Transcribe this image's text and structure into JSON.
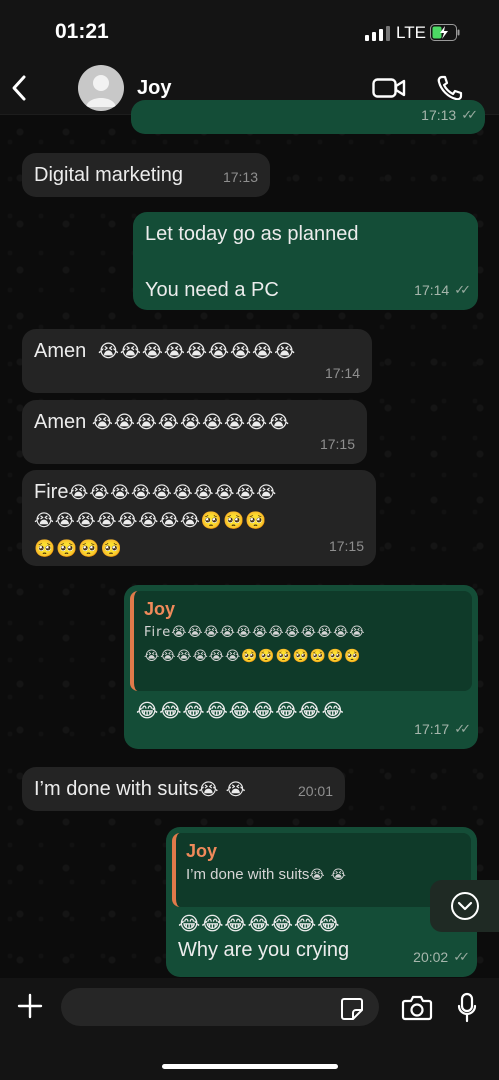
{
  "status": {
    "time": "01:21",
    "network": "LTE"
  },
  "header": {
    "contact_name": "Joy"
  },
  "messages": [
    {
      "id": "m0",
      "dir": "out",
      "text": "",
      "time": "17:13",
      "ticks": "✓✓"
    },
    {
      "id": "m1",
      "dir": "in",
      "text": "Digital marketing",
      "time": "17:13"
    },
    {
      "id": "m2",
      "dir": "out",
      "line1": "Let today go as planned",
      "line2": "You need a PC",
      "time": "17:14",
      "ticks": "✓✓"
    },
    {
      "id": "m3",
      "dir": "in",
      "text": "Amen",
      "emoji": "😭😭😭😭😭😭😭😭😭",
      "time": "17:14"
    },
    {
      "id": "m4",
      "dir": "in",
      "text": "Amen",
      "emoji": "😭😭😭😭😭😭😭😭😭",
      "time": "17:15"
    },
    {
      "id": "m5",
      "dir": "in",
      "text": "Fire",
      "emoji_line1": "😭😭😭😭😭😭😭😭😭😭",
      "emoji_line2": "😭😭😭😭😭😭😭😭🥺🥺🥺",
      "emoji_line3": "🥺🥺🥺🥺",
      "time": "17:15"
    },
    {
      "id": "m6",
      "dir": "out",
      "quote_name": "Joy",
      "quote_line1": "Fire😭😭😭😭😭😭😭😭😭😭😭😭",
      "quote_line2": "😭😭😭😭😭😭🥺🥺🥺🥺🥺🥺🥺",
      "emoji": "😂😂😂😂😂😂😂😂😂",
      "time": "17:17",
      "ticks": "✓✓"
    },
    {
      "id": "m7",
      "dir": "in",
      "text": "I’m done with suits",
      "emoji": "😭 😭",
      "time": "20:01"
    },
    {
      "id": "m8",
      "dir": "out",
      "quote_name": "Joy",
      "quote_text": "I’m done with suits",
      "quote_emoji": "😭 😭",
      "emoji": "😂😂😂😂😂😂😂",
      "text": "Why are you crying",
      "time": "20:02",
      "ticks": "✓✓"
    }
  ],
  "icons": {
    "back": "chevron-left-icon",
    "video": "video-camera-icon",
    "call": "phone-icon",
    "scroll": "chevron-down-icon",
    "attach": "plus-icon",
    "sticker": "sticker-icon",
    "camera": "camera-icon",
    "mic": "microphone-icon"
  },
  "colors": {
    "outgoing": "#144d37",
    "incoming": "#242424",
    "quote_accent": "#f08a5a"
  }
}
